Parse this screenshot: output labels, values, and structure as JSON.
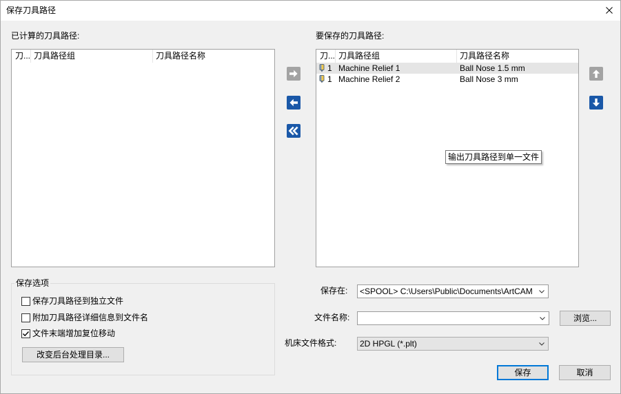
{
  "window": {
    "title": "保存刀具路径",
    "close_icon": "close-icon"
  },
  "calculated_toolpaths": {
    "label": "已计算的刀具路径:",
    "columns": [
      "刀...",
      "刀具路径组",
      "刀具路径名称"
    ],
    "rows": []
  },
  "transfer_buttons": {
    "move_right": {
      "icon": "arrow-right-icon",
      "enabled": false
    },
    "move_left": {
      "icon": "arrow-left-icon",
      "enabled": true
    },
    "move_all_left": {
      "icon": "double-arrow-left-icon",
      "enabled": true
    }
  },
  "toolpaths_to_save": {
    "label": "要保存的刀具路径:",
    "columns": [
      "刀...",
      "刀具路径组",
      "刀具路径名称"
    ],
    "rows": [
      {
        "icon": "toolpath-icon",
        "tool": "1",
        "group": "Machine Relief 1",
        "name": "Ball Nose 1.5 mm",
        "selected": true
      },
      {
        "icon": "toolpath-icon",
        "tool": "1",
        "group": "Machine Relief 2",
        "name": "Ball Nose 3 mm",
        "selected": false
      }
    ]
  },
  "tooltip": {
    "text": "输出刀具路径到单一文件"
  },
  "order_buttons": {
    "move_up": {
      "icon": "arrow-up-icon",
      "enabled": false
    },
    "move_down": {
      "icon": "arrow-down-icon",
      "enabled": true
    }
  },
  "save_options": {
    "legend": "保存选项",
    "checkboxes": [
      {
        "label": "保存刀具路径到独立文件",
        "checked": false
      },
      {
        "label": "附加刀具路径详细信息到文件名",
        "checked": false
      },
      {
        "label": "文件末端增加复位移动",
        "checked": true
      }
    ],
    "change_directory_button": "改变后台处理目录..."
  },
  "save_in": {
    "label": "保存在:",
    "value": "<SPOOL> C:\\Users\\Public\\Documents\\ArtCAM 文件\\To"
  },
  "file_name": {
    "label": "文件名称:",
    "value": "",
    "browse_button": "浏览..."
  },
  "machine_format": {
    "label": "机床文件格式:",
    "value": "2D HPGL (*.plt)"
  },
  "dialog_buttons": {
    "save": "保存",
    "cancel": "取消"
  },
  "colors": {
    "dialog_background": "#f0f0f0",
    "accent_blue": "#1a58a8",
    "disabled_gray": "#a3a3a3",
    "selected_row": "#e5e5e5",
    "default_button_border": "#0078d7"
  }
}
